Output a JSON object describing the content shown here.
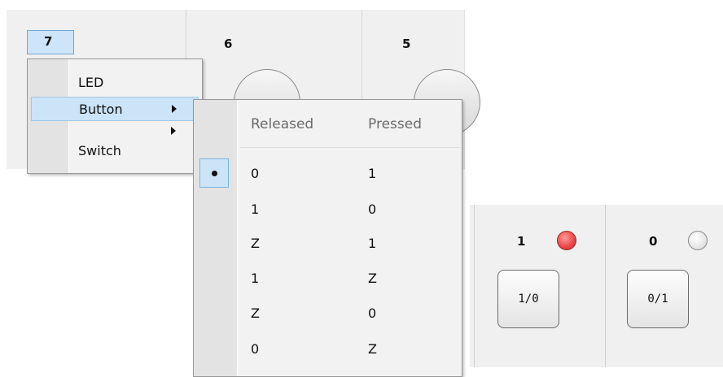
{
  "channels_top": [
    {
      "number": "7"
    },
    {
      "number": "6"
    },
    {
      "number": "5"
    }
  ],
  "context_menu": {
    "items": [
      {
        "label": "LED",
        "has_submenu": false,
        "highlighted": false
      },
      {
        "label": "Button",
        "has_submenu": true,
        "highlighted": true
      },
      {
        "label": "Switch",
        "has_submenu": true,
        "highlighted": false
      }
    ]
  },
  "button_submenu": {
    "headers": {
      "released": "Released",
      "pressed": "Pressed"
    },
    "selected_row": 0,
    "rows": [
      {
        "released": "0",
        "pressed": "1"
      },
      {
        "released": "1",
        "pressed": "0"
      },
      {
        "released": "Z",
        "pressed": "1"
      },
      {
        "released": "1",
        "pressed": "Z"
      },
      {
        "released": "Z",
        "pressed": "0"
      },
      {
        "released": "0",
        "pressed": "Z"
      }
    ]
  },
  "channels_bottom": [
    {
      "number": "1",
      "led_state": "on",
      "led_color": "#e84545",
      "button_label": "1/0"
    },
    {
      "number": "0",
      "led_state": "off",
      "led_color": "#dcdcdc",
      "button_label": "0/1"
    }
  ]
}
